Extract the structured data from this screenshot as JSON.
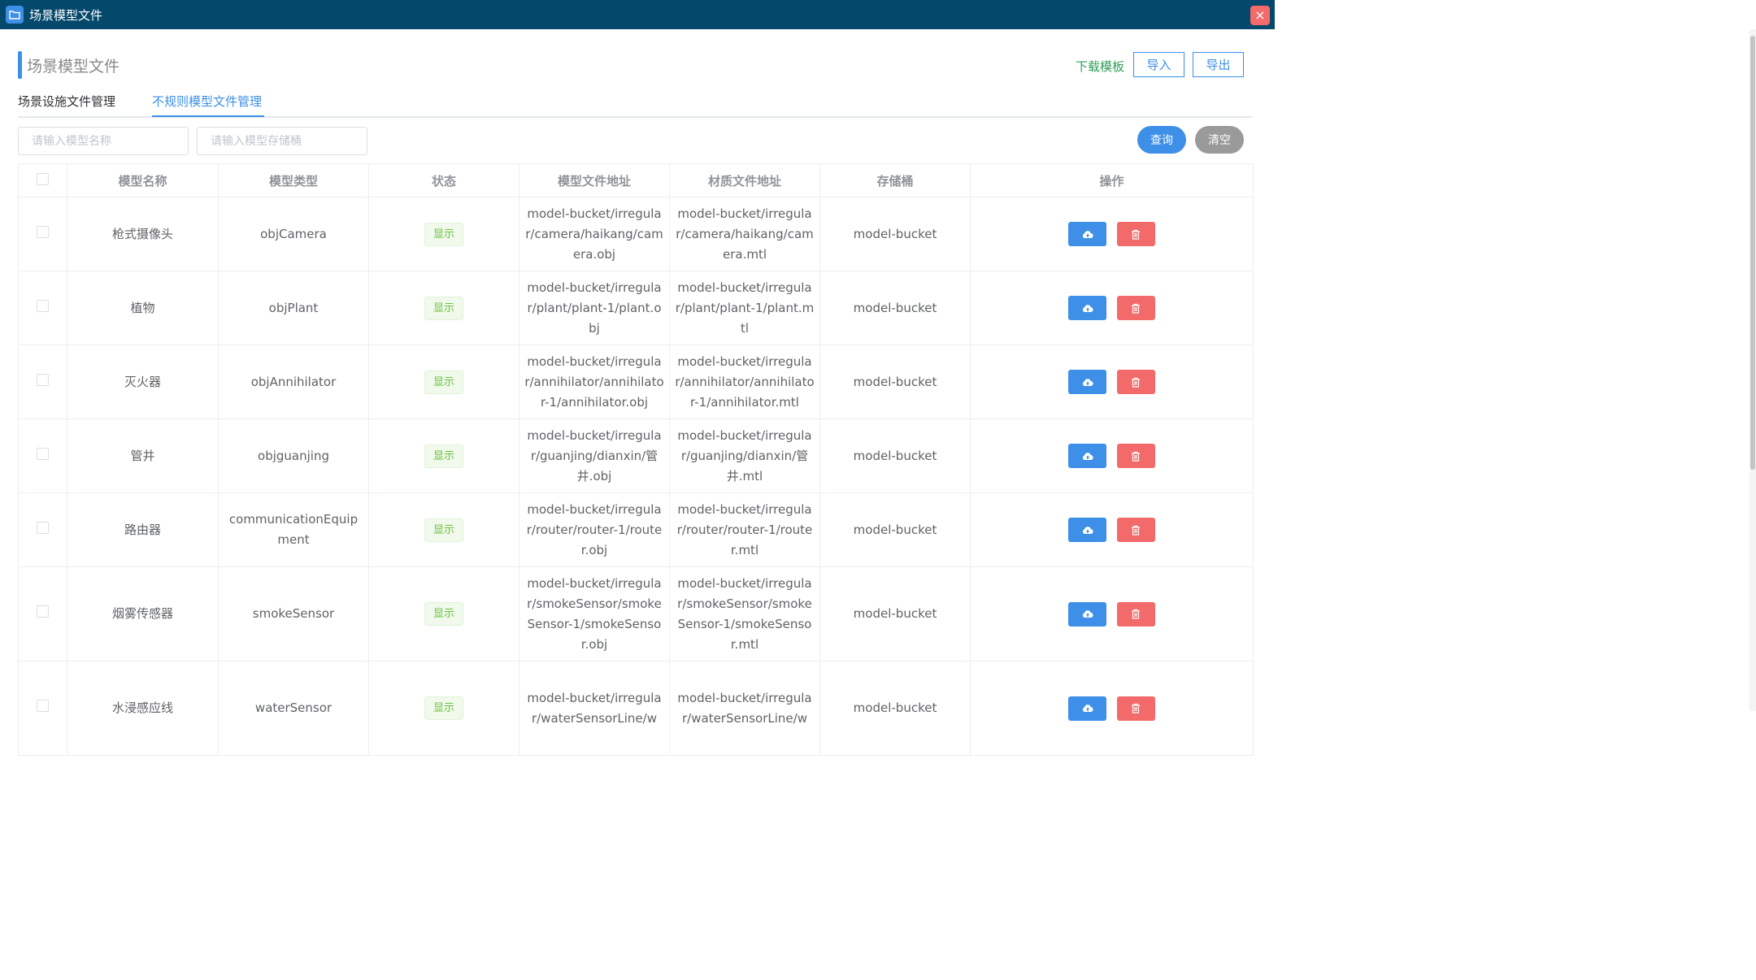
{
  "window": {
    "title": "场景模型文件",
    "close_glyph": "×"
  },
  "header": {
    "section_title": "场景模型文件",
    "download_template": "下载模板",
    "import_label": "导入",
    "export_label": "导出"
  },
  "tabs": [
    {
      "label": "场景设施文件管理",
      "active": false
    },
    {
      "label": "不规则模型文件管理",
      "active": true
    }
  ],
  "search": {
    "name_placeholder": "请输入模型名称",
    "bucket_placeholder": "请输入模型存储桶",
    "query_label": "查询",
    "clear_label": "清空"
  },
  "table": {
    "columns": [
      "模型名称",
      "模型类型",
      "状态",
      "模型文件地址",
      "材质文件地址",
      "存储桶",
      "操作"
    ],
    "rows": [
      {
        "name": "枪式摄像头",
        "type": "objCamera",
        "status": "显示",
        "model_path": "model-bucket/irregular/camera/haikang/camera.obj",
        "material_path": "model-bucket/irregular/camera/haikang/camera.mtl",
        "bucket": "model-bucket"
      },
      {
        "name": "植物",
        "type": "objPlant",
        "status": "显示",
        "model_path": "model-bucket/irregular/plant/plant-1/plant.obj",
        "material_path": "model-bucket/irregular/plant/plant-1/plant.mtl",
        "bucket": "model-bucket"
      },
      {
        "name": "灭火器",
        "type": "objAnnihilator",
        "status": "显示",
        "model_path": "model-bucket/irregular/annihilator/annihilator-1/annihilator.obj",
        "material_path": "model-bucket/irregular/annihilator/annihilator-1/annihilator.mtl",
        "bucket": "model-bucket"
      },
      {
        "name": "管井",
        "type": "objguanjing",
        "status": "显示",
        "model_path": "model-bucket/irregular/guanjing/dianxin/管井.obj",
        "material_path": "model-bucket/irregular/guanjing/dianxin/管井.mtl",
        "bucket": "model-bucket"
      },
      {
        "name": "路由器",
        "type": "communicationEquipment",
        "status": "显示",
        "model_path": "model-bucket/irregular/router/router-1/router.obj",
        "material_path": "model-bucket/irregular/router/router-1/router.mtl",
        "bucket": "model-bucket"
      },
      {
        "name": "烟雾传感器",
        "type": "smokeSensor",
        "status": "显示",
        "model_path": "model-bucket/irregular/smokeSensor/smokeSensor-1/smokeSensor.obj",
        "material_path": "model-bucket/irregular/smokeSensor/smokeSensor-1/smokeSensor.mtl",
        "bucket": "model-bucket"
      },
      {
        "name": "水浸感应线",
        "type": "waterSensor",
        "status": "显示",
        "model_path": "model-bucket/irregular/waterSensorLine/w",
        "material_path": "model-bucket/irregular/waterSensorLine/w",
        "bucket": "model-bucket"
      }
    ]
  },
  "icons": {
    "app": "folder-icon",
    "close": "close-icon",
    "upload": "cloud-upload-icon",
    "delete": "trash-icon"
  },
  "colors": {
    "titlebar": "#04486b",
    "primary": "#3d8fe8",
    "success_text": "#67c23a",
    "danger": "#f26a6a",
    "download_link": "#2f9e57",
    "clear_button": "#9a9a9a"
  }
}
